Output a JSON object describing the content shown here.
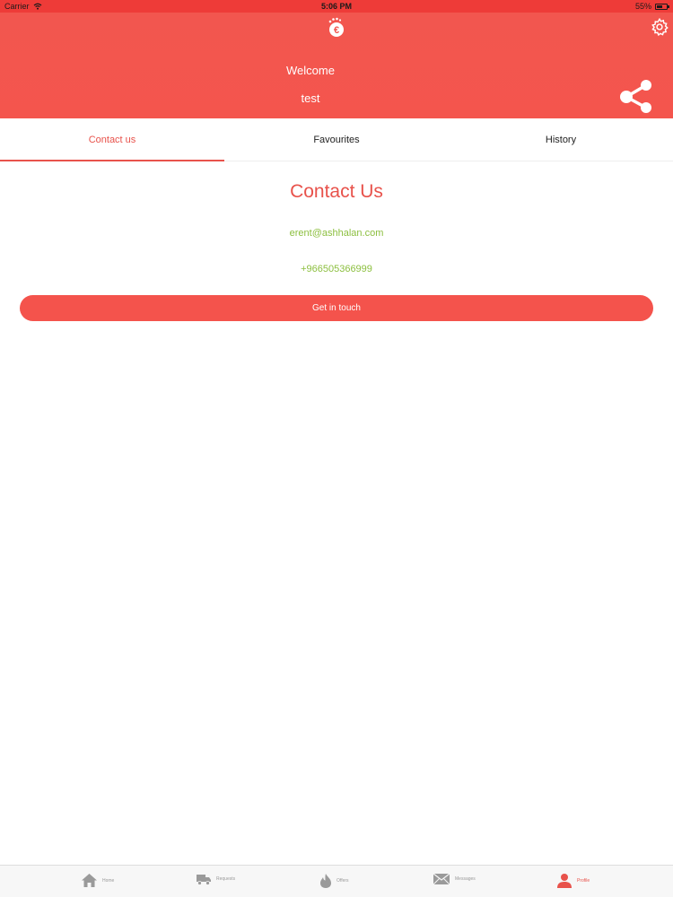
{
  "status_bar": {
    "carrier": "Carrier",
    "time": "5:06 PM",
    "battery": "55%",
    "battery_level": 0.55
  },
  "header": {
    "welcome": "Welcome",
    "username": "test"
  },
  "tabs": [
    {
      "label": "Contact us",
      "active": true
    },
    {
      "label": "Favourites",
      "active": false
    },
    {
      "label": "History",
      "active": false
    }
  ],
  "contact": {
    "title": "Contact Us",
    "email": "erent@ashhalan.com",
    "phone": "+966505366999",
    "button": "Get in touch"
  },
  "bottom_nav": [
    {
      "label": "Home",
      "icon": "home-icon"
    },
    {
      "label": "Requests",
      "icon": "truck-icon"
    },
    {
      "label": "Offers",
      "icon": "flame-icon"
    },
    {
      "label": "Messages",
      "icon": "mail-icon"
    },
    {
      "label": "Profile",
      "icon": "user-icon",
      "active": true
    }
  ],
  "colors": {
    "accent": "#f4534c",
    "link": "#8cbf3f",
    "inactive": "#9a9a9a"
  }
}
